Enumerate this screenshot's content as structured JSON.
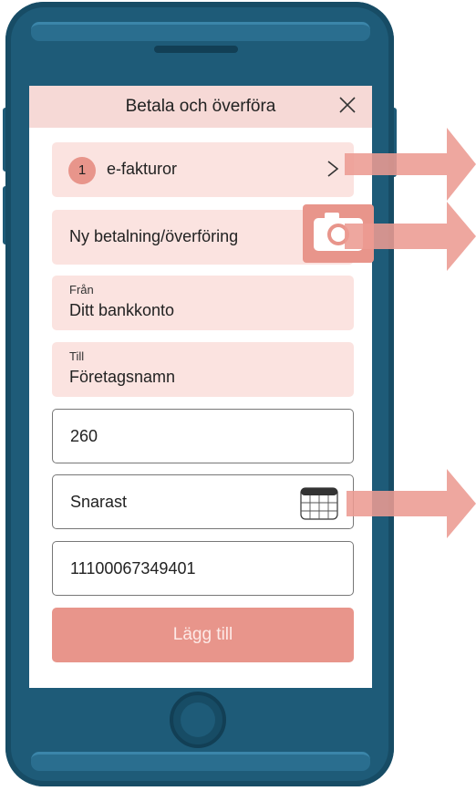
{
  "header": {
    "title": "Betala och överföra"
  },
  "efakturor": {
    "count": "1",
    "label": "e-fakturor"
  },
  "new_payment": {
    "label": "Ny betalning/överföring"
  },
  "from": {
    "label": "Från",
    "value": "Ditt bankkonto"
  },
  "to": {
    "label": "Till",
    "value": "Företagsnamn"
  },
  "amount": {
    "value": "260"
  },
  "date": {
    "value": "Snarast"
  },
  "reference": {
    "value": "11100067349401"
  },
  "add_button": {
    "label": "Lägg till"
  },
  "icons": [
    "close-icon",
    "chevron-right-icon",
    "camera-icon",
    "calendar-icon",
    "arrow-right-icon"
  ],
  "colors": {
    "accent": "#e8958b",
    "row_bg": "#fbe3e0",
    "header_bg": "#f6d9d6",
    "phone": "#1e5b78",
    "arrow": "#ec9b92"
  }
}
